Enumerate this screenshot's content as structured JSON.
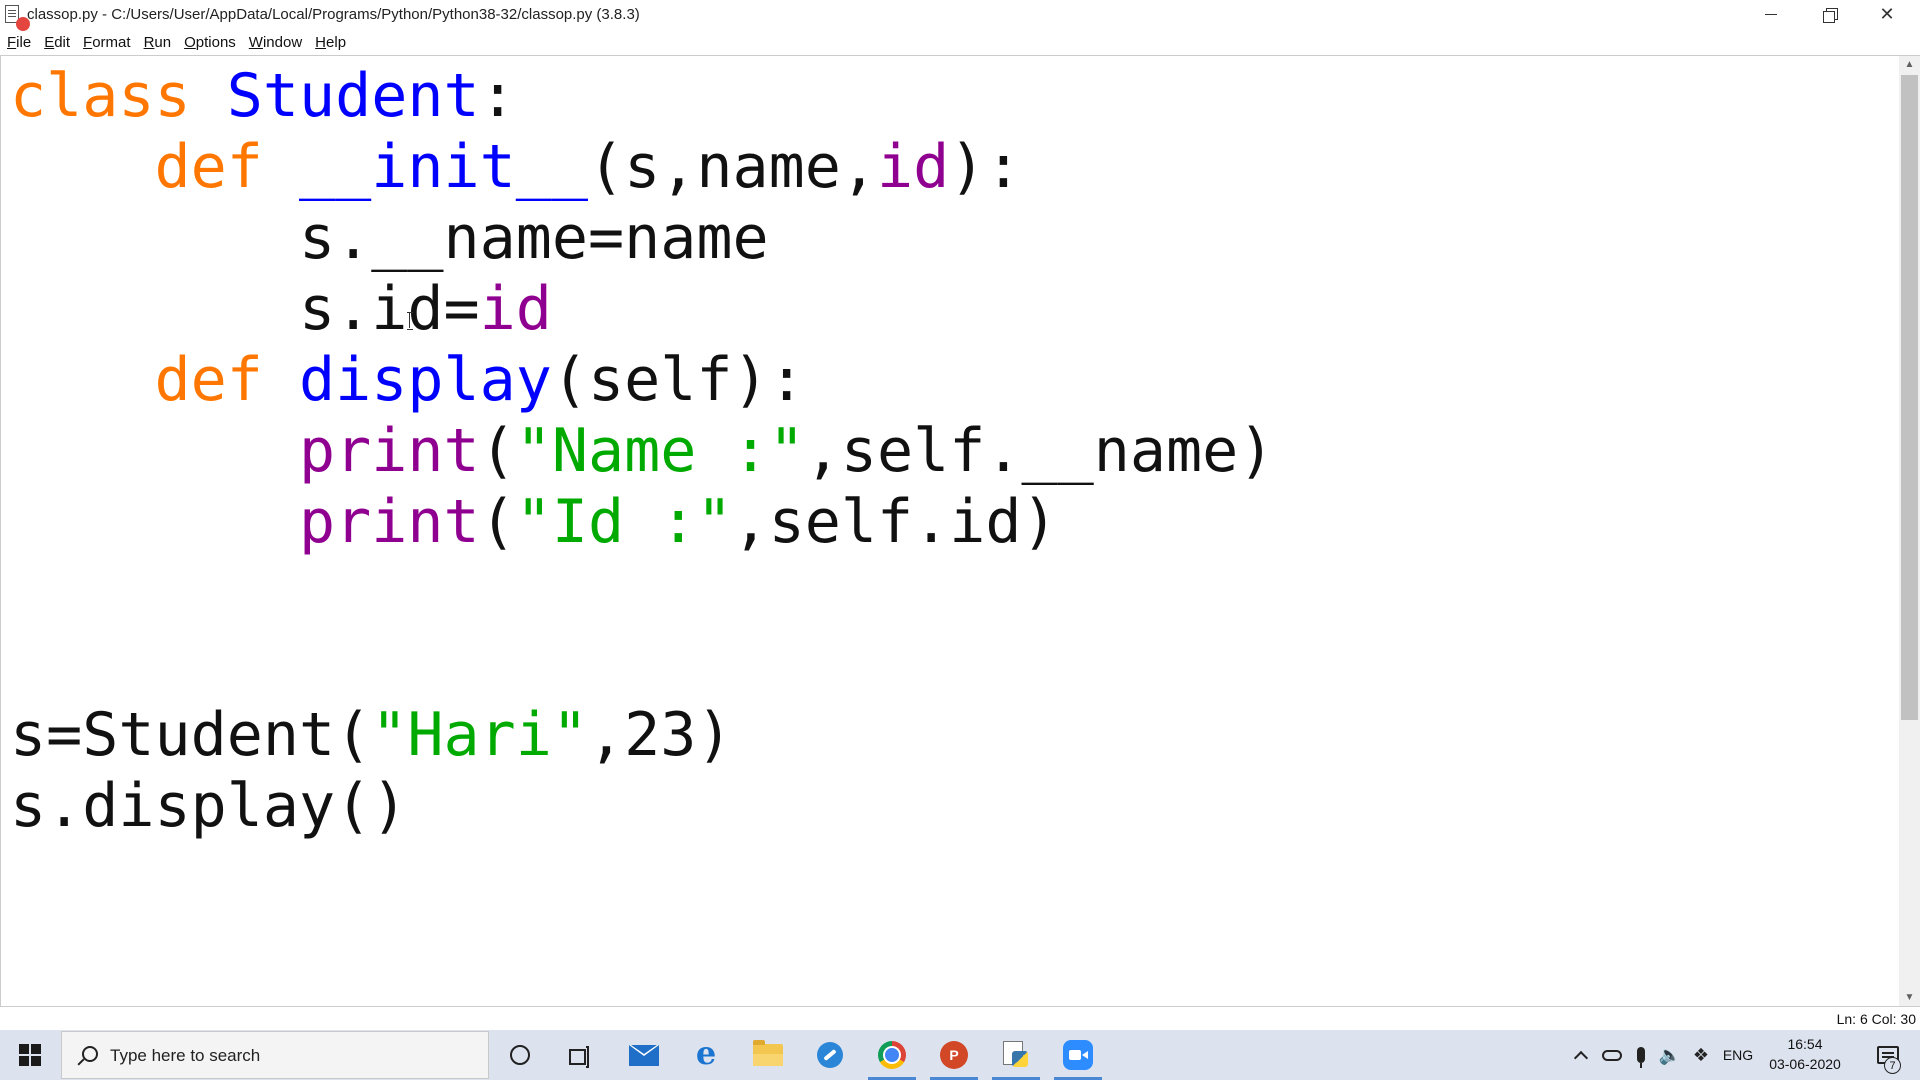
{
  "window": {
    "title": "classop.py - C:/Users/User/AppData/Local/Programs/Python/Python38-32/classop.py (3.8.3)",
    "minimize_glyph": "—",
    "close_glyph": "✕"
  },
  "menu": [
    {
      "label": "File",
      "accel": "F",
      "rest": "ile"
    },
    {
      "label": "Edit",
      "accel": "E",
      "rest": "dit"
    },
    {
      "label": "Format",
      "accel": "F",
      "rest": "ormat"
    },
    {
      "label": "Run",
      "accel": "R",
      "rest": "un"
    },
    {
      "label": "Options",
      "accel": "O",
      "rest": "ptions"
    },
    {
      "label": "Window",
      "accel": "W",
      "rest": "indow"
    },
    {
      "label": "Help",
      "accel": "H",
      "rest": "elp"
    }
  ],
  "editor": {
    "lines": [
      [
        {
          "t": "class",
          "c": "kw"
        },
        {
          "t": " ",
          "c": ""
        },
        {
          "t": "Student",
          "c": "def"
        },
        {
          "t": ":",
          "c": ""
        }
      ],
      [
        {
          "t": "    ",
          "c": ""
        },
        {
          "t": "def",
          "c": "kw"
        },
        {
          "t": " ",
          "c": ""
        },
        {
          "t": "__init__",
          "c": "def"
        },
        {
          "t": "(s,name,",
          "c": ""
        },
        {
          "t": "id",
          "c": "bi"
        },
        {
          "t": "):",
          "c": ""
        }
      ],
      [
        {
          "t": "        s.__name=name",
          "c": ""
        }
      ],
      [
        {
          "t": "        s.id=",
          "c": ""
        },
        {
          "t": "id",
          "c": "bi"
        }
      ],
      [
        {
          "t": "    ",
          "c": ""
        },
        {
          "t": "def",
          "c": "kw"
        },
        {
          "t": " ",
          "c": ""
        },
        {
          "t": "display",
          "c": "def"
        },
        {
          "t": "(self):",
          "c": ""
        }
      ],
      [
        {
          "t": "        ",
          "c": ""
        },
        {
          "t": "print",
          "c": "bi"
        },
        {
          "t": "(",
          "c": ""
        },
        {
          "t": "\"Name :\"",
          "c": "str"
        },
        {
          "t": ",self.__name)",
          "c": ""
        }
      ],
      [
        {
          "t": "        ",
          "c": ""
        },
        {
          "t": "print",
          "c": "bi"
        },
        {
          "t": "(",
          "c": ""
        },
        {
          "t": "\"Id :\"",
          "c": "str"
        },
        {
          "t": ",self.id)",
          "c": ""
        }
      ],
      [
        {
          "t": "",
          "c": ""
        }
      ],
      [
        {
          "t": "",
          "c": ""
        }
      ],
      [
        {
          "t": "s=Student(",
          "c": ""
        },
        {
          "t": "\"Hari\"",
          "c": "str"
        },
        {
          "t": ",23)",
          "c": ""
        }
      ],
      [
        {
          "t": "s.display()",
          "c": ""
        }
      ]
    ]
  },
  "status": {
    "position": "Ln: 6  Col: 30"
  },
  "taskbar": {
    "search_placeholder": "Type here to search",
    "ppt_letter": "P",
    "tray": {
      "language": "ENG",
      "time": "16:54",
      "date": "03-06-2020",
      "notification_count": "7"
    },
    "icons": [
      "start-icon",
      "search-icon",
      "cortana-icon",
      "task-view-icon",
      "mail-icon",
      "edge-icon",
      "file-explorer-icon",
      "blue-app-icon",
      "chrome-icon",
      "powerpoint-icon",
      "python-idle-icon",
      "zoom-icon"
    ]
  }
}
